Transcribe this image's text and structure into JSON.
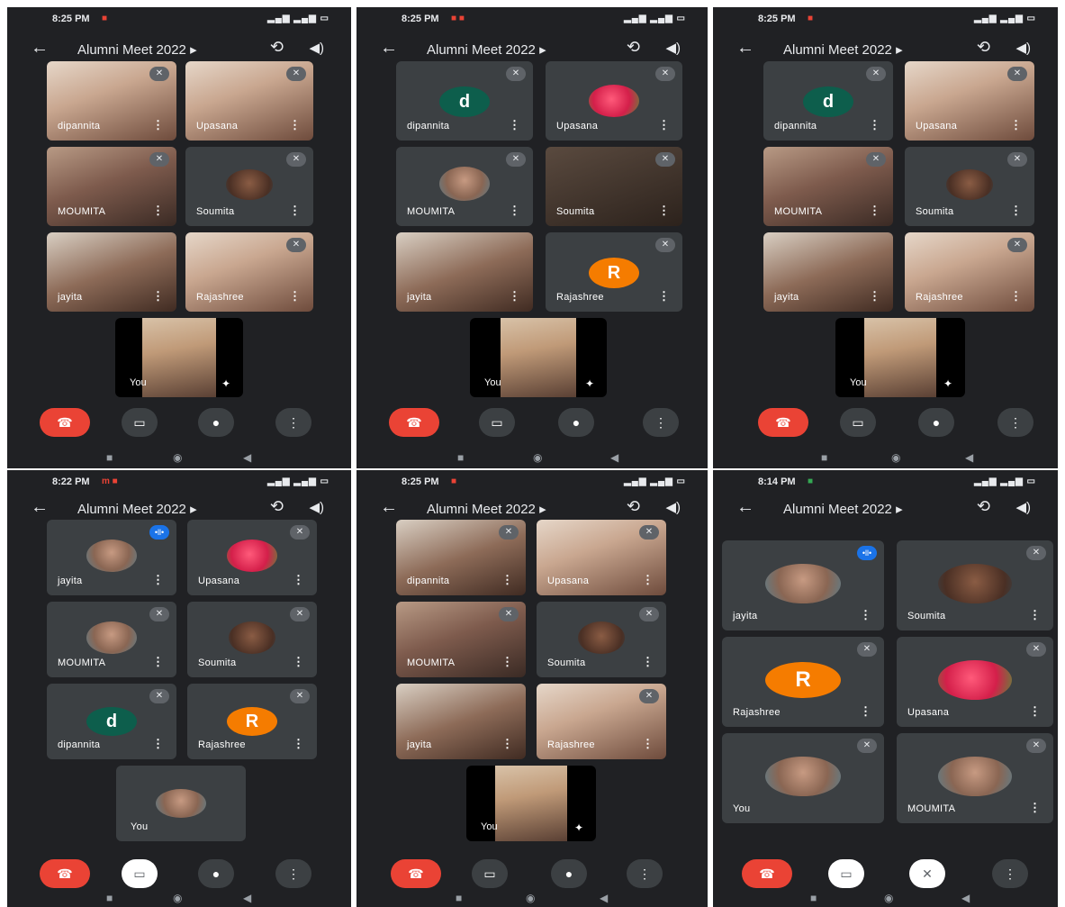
{
  "panels": [
    {
      "time": "8:25 PM",
      "title": "Alumni Meet 2022 ▸",
      "tiles": [
        {
          "name": "dipannita"
        },
        {
          "name": "Upasana"
        },
        {
          "name": "MOUMITA"
        },
        {
          "name": "Soumita"
        },
        {
          "name": "jayita"
        },
        {
          "name": "Rajashree"
        }
      ],
      "self_label": "You"
    },
    {
      "time": "8:25 PM",
      "title": "Alumni Meet 2022 ▸",
      "tiles": [
        {
          "name": "dipannita",
          "avatar": "d"
        },
        {
          "name": "Upasana"
        },
        {
          "name": "MOUMITA"
        },
        {
          "name": "Soumita"
        },
        {
          "name": "jayita"
        },
        {
          "name": "Rajashree",
          "avatar": "R"
        }
      ],
      "self_label": "You"
    },
    {
      "time": "8:25 PM",
      "title": "Alumni Meet 2022 ▸",
      "tiles": [
        {
          "name": "dipannita",
          "avatar": "d"
        },
        {
          "name": "Upasana"
        },
        {
          "name": "MOUMITA"
        },
        {
          "name": "Soumita"
        },
        {
          "name": "jayita"
        },
        {
          "name": "Rajashree"
        }
      ],
      "self_label": "You"
    },
    {
      "time": "8:22 PM",
      "title": "Alumni Meet 2022 ▸",
      "tiles": [
        {
          "name": "jayita"
        },
        {
          "name": "Upasana"
        },
        {
          "name": "MOUMITA"
        },
        {
          "name": "Soumita"
        },
        {
          "name": "dipannita",
          "avatar": "d"
        },
        {
          "name": "Rajashree",
          "avatar": "R"
        }
      ],
      "self_label": "You"
    },
    {
      "time": "8:25 PM",
      "title": "Alumni Meet 2022 ▸",
      "tiles": [
        {
          "name": "dipannita"
        },
        {
          "name": "Upasana"
        },
        {
          "name": "MOUMITA"
        },
        {
          "name": "Soumita"
        },
        {
          "name": "jayita"
        },
        {
          "name": "Rajashree"
        }
      ],
      "self_label": "You"
    },
    {
      "time": "8:14 PM",
      "title": "Alumni Meet 2022 ▸",
      "tiles": [
        {
          "name": "jayita"
        },
        {
          "name": "Soumita"
        },
        {
          "name": "Rajashree",
          "avatar": "R"
        },
        {
          "name": "Upasana"
        },
        {
          "name": "You"
        },
        {
          "name": "MOUMITA"
        }
      ]
    }
  ],
  "icons": {
    "back": "←",
    "camera_switch": "⟲",
    "speaker": "◀)",
    "more": "⋮",
    "mic_muted": "✕",
    "end_call": "☎",
    "camera": "▭",
    "mic": "●",
    "nav_home": "◉",
    "nav_back": "◀",
    "nav_recent": "■",
    "effects": "✦"
  },
  "colors": {
    "background": "#202124",
    "tile": "#3c4043",
    "end_call": "#ea4335",
    "avatar_d": "#0d5e4c",
    "avatar_r": "#f57c00",
    "speaking": "#1a73e8"
  }
}
